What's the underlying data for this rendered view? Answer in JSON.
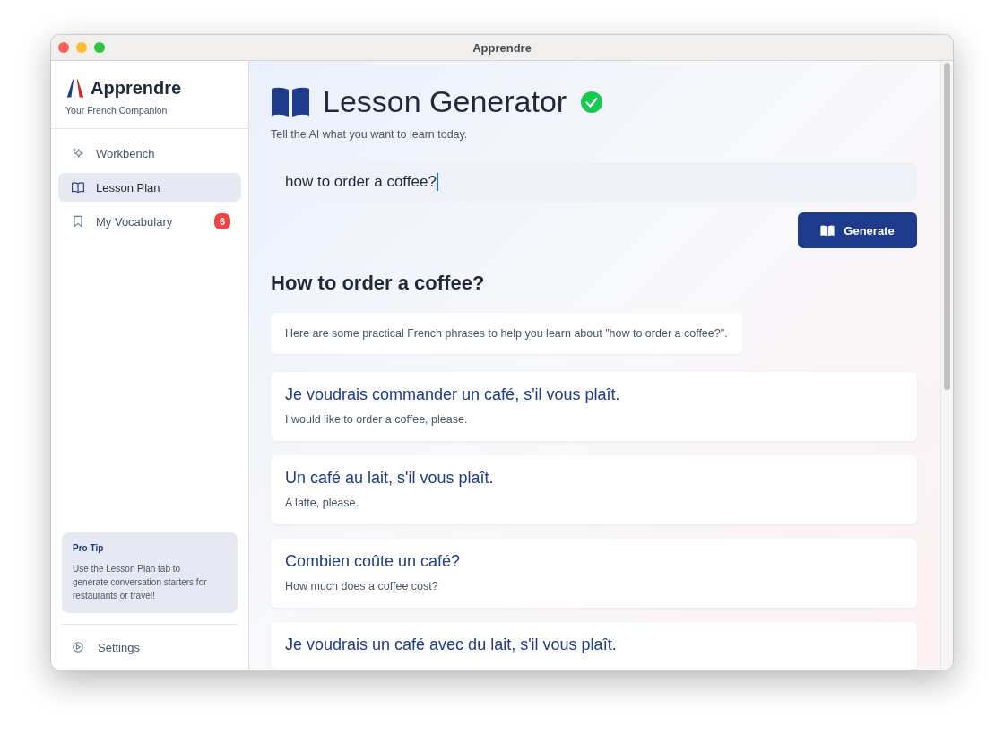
{
  "window": {
    "title": "Apprendre"
  },
  "sidebar": {
    "brand": "Apprendre",
    "tagline": "Your French Companion",
    "items": [
      {
        "kind": "sparkle",
        "label": "Workbench",
        "selected": false
      },
      {
        "kind": "book",
        "label": "Lesson Plan",
        "selected": true
      },
      {
        "kind": "bookmark",
        "label": "My Vocabulary",
        "selected": false,
        "badge": "6"
      }
    ],
    "tip": {
      "title": "Pro Tip",
      "text": "Use the Lesson Plan tab to generate conversation starters for restaurants or travel!"
    },
    "settings": "Settings"
  },
  "main": {
    "title": "Lesson Generator",
    "verified": true,
    "subtitle": "Tell the AI what you want to learn today.",
    "prompt": {
      "value": "how to order a coffee?"
    },
    "button": "Generate",
    "lesson_title": "How to order a coffee?",
    "intro": "Here are some practical French phrases to help you learn about \"how to order a coffee?\".",
    "phrases": [
      {
        "french": "Je voudrais commander un café, s'il vous plaît.",
        "english": "I would like to order a coffee, please."
      },
      {
        "french": "Un café au lait, s'il vous plaît.",
        "english": "A latte, please."
      },
      {
        "french": "Combien coûte un café?",
        "english": "How much does a coffee cost?"
      },
      {
        "french": "Je voudrais un café avec du lait, s'il vous plaît."
      }
    ]
  }
}
